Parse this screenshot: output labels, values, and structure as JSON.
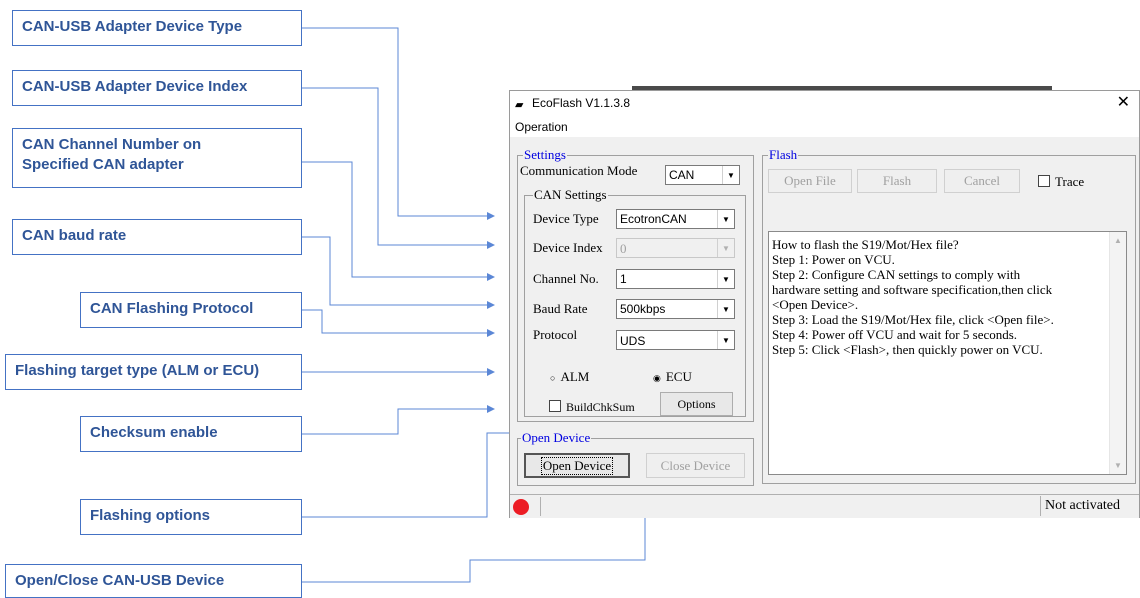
{
  "callouts": {
    "device_type": "CAN-USB Adapter Device Type",
    "device_index": "CAN-USB Adapter Device  Index",
    "channel_line1": "CAN Channel Number on",
    "channel_line2": "Specified CAN adapter",
    "baud_rate": "CAN baud rate",
    "protocol": "CAN Flashing Protocol",
    "target_type": "Flashing target type (ALM or ECU)",
    "checksum": "Checksum enable",
    "options": "Flashing options",
    "open_close": "Open/Close CAN-USB Device"
  },
  "window": {
    "title": "EcoFlash V1.1.3.8",
    "close_glyph": "✕",
    "menu": "Operation"
  },
  "settings": {
    "group_label": "Settings",
    "comm_mode_label": "Communication Mode",
    "comm_mode_value": "CAN",
    "can_settings_label": "CAN Settings",
    "device_type_label": "Device Type",
    "device_type_value": "EcotronCAN",
    "device_index_label": "Device Index",
    "device_index_value": "0",
    "channel_label": "Channel No.",
    "channel_value": "1",
    "baud_label": "Baud Rate",
    "baud_value": "500kbps",
    "protocol_label": "Protocol",
    "protocol_value": "UDS",
    "radio_alm": "ALM",
    "radio_ecu": "ECU",
    "selected_target": "ECU",
    "checksum_label": "BuildChkSum",
    "checksum_checked": false,
    "options_button": "Options"
  },
  "open_device": {
    "group_label": "Open Device",
    "open_button": "Open Device",
    "close_button": "Close Device"
  },
  "flash": {
    "group_label": "Flash",
    "open_file_button": "Open File",
    "flash_button": "Flash",
    "cancel_button": "Cancel",
    "trace_label": "Trace",
    "trace_checked": false,
    "instructions": [
      "How to flash the S19/Mot/Hex file?",
      "Step 1: Power on VCU.",
      "Step 2: Configure CAN settings to comply with",
      "hardware setting and software specification,then click",
      "<Open Device>.",
      "Step 3: Load the S19/Mot/Hex file, click <Open file>.",
      "Step 4: Power off VCU and wait for 5 seconds.",
      "Step 5: Click <Flash>, then quickly power on VCU."
    ]
  },
  "status": {
    "text": "Not activated",
    "indicator_color": "#ec1c24"
  },
  "icons": {
    "app": "car-icon",
    "dropdown": "triangle-down",
    "radio_on": "◉",
    "radio_off": "○"
  },
  "colors": {
    "callout_border": "#4472c4",
    "callout_text": "#2f5597",
    "group_label": "#0000e0"
  }
}
